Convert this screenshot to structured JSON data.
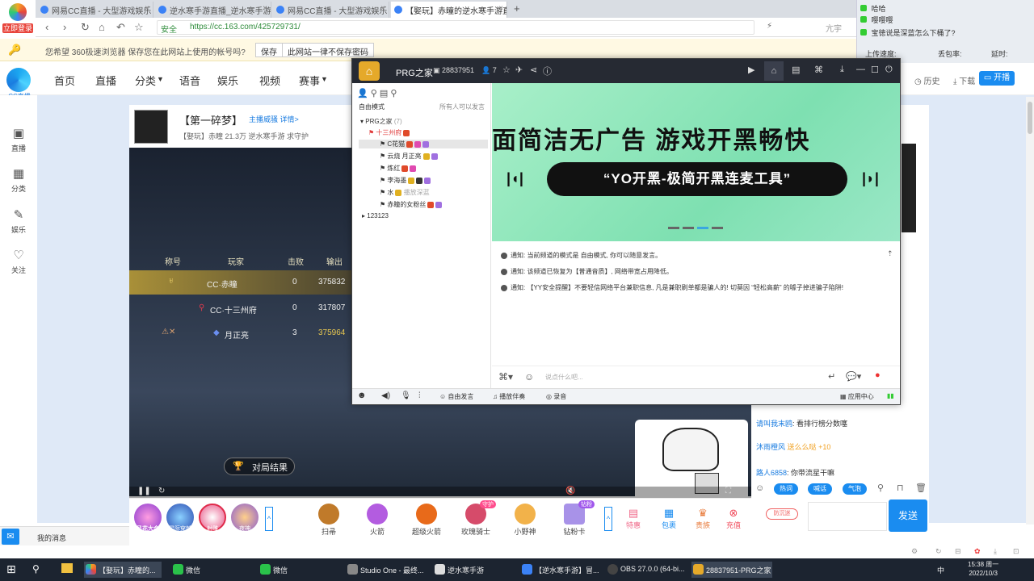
{
  "browser": {
    "badge": "立即登录",
    "tabs": [
      {
        "title": "网易CC直播 - 大型游戏娱乐"
      },
      {
        "title": "逆水寒手游直播_逆水寒手游"
      },
      {
        "title": "网易CC直播 - 大型游戏娱乐"
      },
      {
        "title": "【娶玩】赤瞳的逆水寒手游直"
      }
    ],
    "new_tab": "+",
    "url": "https://cc.163.com/425729731/",
    "safe_label": "安全",
    "search_hint": "亢宇"
  },
  "password_bar": {
    "message": "您希望 360极速浏览器 保存您在此网站上使用的帐号吗?",
    "save": "保存",
    "never": "此网站一律不保存密码"
  },
  "notifications": {
    "lines": [
      {
        "user": "",
        "text": "哈哈"
      },
      {
        "user": "",
        "text": "嘤嘤嘤"
      },
      {
        "user": "",
        "text": "宝徳说是深蓝怎么下桶了?"
      }
    ],
    "stats": [
      "上传速度:",
      "丢包率:",
      "延时:"
    ]
  },
  "cc_header": {
    "logo_text": "CC直播",
    "nav": [
      "首页",
      "直播",
      "分类",
      "语音",
      "娱乐",
      "视频",
      "赛事"
    ],
    "history": "历史",
    "download": "下载",
    "start_live": "开播"
  },
  "sidebar": {
    "items": [
      {
        "label": "直播",
        "icon": "tv-icon"
      },
      {
        "label": "分类",
        "icon": "grid-icon"
      },
      {
        "label": "娱乐",
        "icon": "mic-icon"
      },
      {
        "label": "关注",
        "icon": "heart-icon"
      }
    ]
  },
  "stream": {
    "title": "【第一碎梦】",
    "follow": "主播威骚 详情>",
    "meta": "【娶玩】赤瞳   21.3万   逆水寒手游   求守护"
  },
  "scoreboard": {
    "headers": [
      "称号",
      "玩家",
      "击败",
      "输出"
    ],
    "rows": [
      {
        "player": "CC·赤瞳",
        "kills": "0",
        "damage": "375832"
      },
      {
        "player": "CC·十三州府",
        "kills": "0",
        "damage": "317807"
      },
      {
        "player": "月正亮",
        "kills": "3",
        "damage": "375964"
      }
    ],
    "result_button": "对局结果"
  },
  "gifts": {
    "round_items": [
      "风花大会",
      "星际穿越",
      "射雕",
      "夜神"
    ],
    "items": [
      {
        "label": "扫帚",
        "badge": ""
      },
      {
        "label": "火箭",
        "badge": ""
      },
      {
        "label": "超级火箭",
        "badge": ""
      },
      {
        "label": "玫瑰骑士",
        "badge": "守护"
      },
      {
        "label": "小野神",
        "badge": ""
      },
      {
        "label": "钻粉卡",
        "badge": "钻粉"
      }
    ],
    "extra": [
      "特惠",
      "包裹",
      "贵族",
      "充值"
    ],
    "expand": "^"
  },
  "chat": {
    "messages": [
      {
        "user": "请叫我末鸥",
        "text": ": 看排行榜分数噻"
      },
      {
        "user": "沐雨橙风",
        "text": "送么么哒",
        "suffix": "+10"
      },
      {
        "user": "路人6858",
        "text": ": 你带流星干嘛"
      }
    ],
    "chips": [
      "热词",
      "喊话",
      "气泡"
    ],
    "fangou": "防沉迷",
    "send": "发送"
  },
  "message_bar": {
    "label": "我的消息"
  },
  "prg": {
    "name": "PRG之家",
    "id": "28837951",
    "count": "7",
    "mode": "自由模式",
    "mode_hint": "所有人可以发言",
    "tree": [
      {
        "label": "PRG之家",
        "suffix": "(7)"
      },
      {
        "label": "十三州府"
      },
      {
        "label": "C花猫"
      },
      {
        "label": "云烧 月正亮"
      },
      {
        "label": "炼红"
      },
      {
        "label": "李海墨"
      },
      {
        "label": "水",
        "suffix": "播放深蓝"
      },
      {
        "label": "赤瞳的女粉丝"
      },
      {
        "label": "123123"
      }
    ],
    "banner_headline": "面简洁无广告  游戏开黑畅快",
    "banner_pill": "“YO开黑-极简开黑连麦工具”",
    "notices": [
      "通知: 当前频道的模式是 自由模式, 你可以随意发言。",
      "通知: 该频道已恢复为【普通音质】, 网络带宽占用降低。",
      "通知: 【YY安全提醒】不要轻信网络平台兼职信息, 凡是兼职刷单都是骗人的! 切莫因 “轻松高薪” 的噱子掉进骗子陷阱!"
    ],
    "input_placeholder": "说点什么吧...",
    "bottom": {
      "free_speak": "自由发言",
      "accompany": "播放伴奏",
      "record": "录音",
      "app_center": "应用中心"
    }
  },
  "taskbar": {
    "items": [
      {
        "label": "【娶玩】赤瞳的..."
      },
      {
        "label": "微信"
      },
      {
        "label": "微信"
      },
      {
        "label": "Studio One - 最终..."
      },
      {
        "label": "逆水寒手游"
      },
      {
        "label": "【逆水寒手游】冒..."
      },
      {
        "label": "OBS 27.0.0 (64-bi..."
      },
      {
        "label": "28837951-PRG之家"
      }
    ],
    "time": "15:38 周一",
    "date": "2022/10/3",
    "tray": "中"
  }
}
